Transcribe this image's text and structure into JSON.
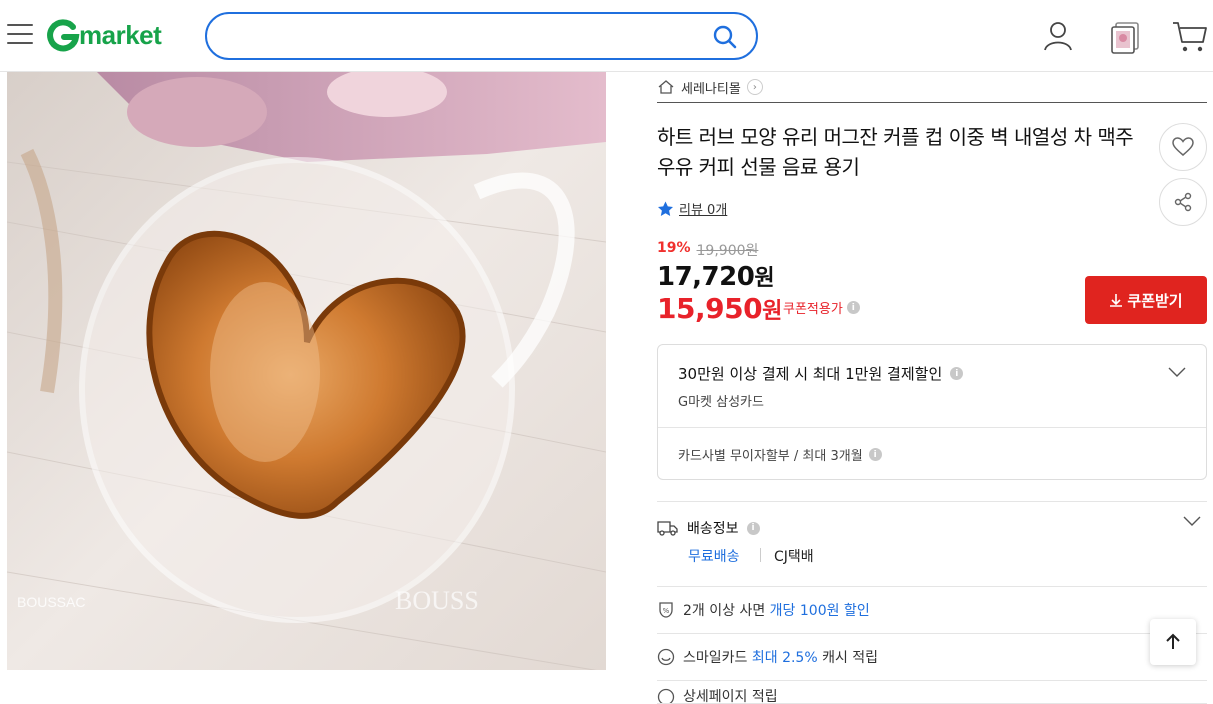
{
  "header": {
    "logo_text": "market",
    "search_placeholder": "",
    "icons": [
      "menu-icon",
      "search-icon",
      "user-icon",
      "recent-items-icon",
      "cart-icon"
    ],
    "accent": "#1f6fde",
    "brand": "#17a34a"
  },
  "product": {
    "image_watermarks": [
      "BOUSSAC",
      "BOUSS"
    ],
    "store_name": "세레나티몰",
    "title": "하트 러브 모양 유리 머그잔 커플 컵 이중 벽 내열성 차 맥주 우유 커피 선물 음료 용기",
    "review_label": "리뷰 0개",
    "discount_rate": "19%",
    "original_price": "19,900원",
    "price_number": "17,720",
    "price_unit": "원",
    "coupon_price_number": "15,950",
    "coupon_price_unit": "원",
    "coupon_applied_label": "쿠폰적용가",
    "coupon_button": "쿠폰받기",
    "sale_color": "#e8222a"
  },
  "card_benefit": {
    "title": "30만원 이상 결제 시 최대 1만원 결제할인",
    "card_name": "G마켓 삼성카드",
    "installment": "카드사별 무이자할부 / 최대 3개월"
  },
  "shipping": {
    "title": "배송정보",
    "free_label": "무료배송",
    "courier": "CJ택배"
  },
  "benefits": [
    {
      "prefix": "2개 이상 사면 ",
      "highlight": "개당 100원 할인",
      "suffix": ""
    },
    {
      "prefix": "스마일카드 ",
      "highlight": "최대 2.5%",
      "suffix": " 캐시 적립"
    }
  ],
  "partial_row": "상세페이지 적립"
}
